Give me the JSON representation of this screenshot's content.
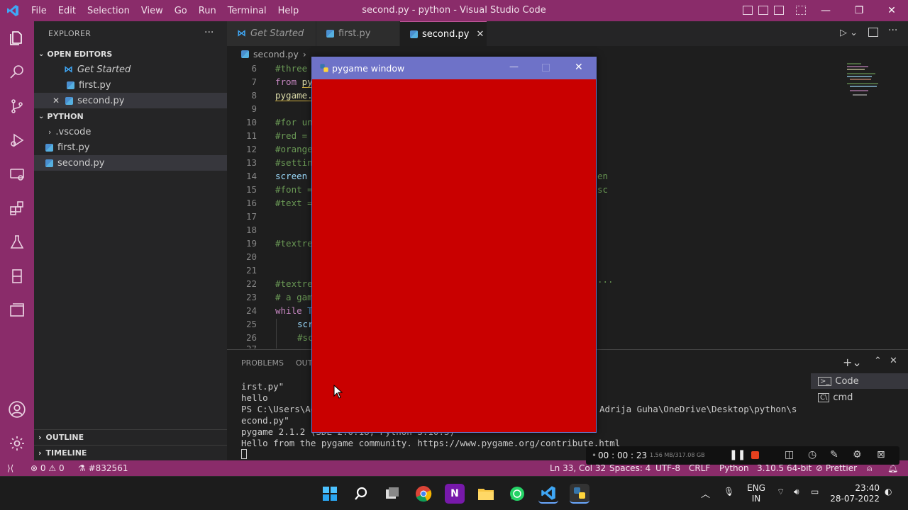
{
  "window": {
    "title": "second.py - python - Visual Studio Code",
    "menu": [
      "File",
      "Edit",
      "Selection",
      "View",
      "Go",
      "Run",
      "Terminal",
      "Help"
    ]
  },
  "explorer": {
    "title": "EXPLORER",
    "open_editors_label": "OPEN EDITORS",
    "open_editors": [
      "Get Started",
      "first.py",
      "second.py"
    ],
    "folder_label": "PYTHON",
    "files": [
      ".vscode",
      "first.py",
      "second.py"
    ],
    "outline_label": "OUTLINE",
    "timeline_label": "TIMELINE"
  },
  "tabs": [
    "Get Started",
    "first.py",
    "second.py"
  ],
  "breadcrumb": "second.py",
  "editor": {
    "line_numbers": [
      "6",
      "7",
      "8",
      "9",
      "10",
      "11",
      "12",
      "13",
      "14",
      "15",
      "16",
      "17",
      "18",
      "19",
      "20",
      "21",
      "22",
      "23",
      "24",
      "25",
      "26",
      "27"
    ],
    "visible_code": {
      "l6": "#three",
      "l7a": "from ",
      "l7b": "py",
      "l8": "pygame.",
      "l10": "#for un",
      "l11": "#red = ",
      "l12": "#orange",
      "l13": "#settin",
      "l14": "screen ",
      "l14r": "en",
      "l15": "#font =",
      "l15r": "sc",
      "l16": "#text =",
      "l19": "#textre",
      "l22": "#textre",
      "l22r": "...",
      "l23": "# a gam",
      "l24a": "while ",
      "l24b": "T",
      "l25": "scr",
      "l26": "#sc"
    }
  },
  "panel": {
    "tabs": [
      "PROBLEMS",
      "OUT"
    ],
    "terminal_lines": [
      "irst.py\"",
      "hello",
      "PS C:\\Users\\Ad",
      "econd.py\"",
      "pygame 2.1.2 (SDL 2.0.18, Python 3.10.5)",
      "Hello from the pygame community. https://www.pygame.org/contribute.html"
    ],
    "path_fragment": "Adrija Guha\\OneDrive\\Desktop\\python\\s",
    "terminals": [
      "Code",
      "cmd"
    ]
  },
  "pygame_window": {
    "title": "pygame window",
    "fill_color": "#c90000"
  },
  "recorder": {
    "time": "00 : 00 : 23",
    "size": "1.56 MB/317.08 GB"
  },
  "statusbar": {
    "errors": "0",
    "warnings": "0",
    "branch": "#832561",
    "position": "Ln 33, Col 32",
    "spaces": "Spaces: 4",
    "encoding": "UTF-8",
    "eol": "CRLF",
    "language": "Python",
    "interpreter": "3.10.5 64-bit",
    "prettier": "Prettier"
  },
  "taskbar": {
    "lang1": "ENG",
    "lang2": "IN",
    "time": "23:40",
    "date": "28-07-2022"
  },
  "colors": {
    "accent": "#8a2c6a",
    "pygame_red": "#c90000",
    "pygame_titlebar": "#6e72c8"
  }
}
